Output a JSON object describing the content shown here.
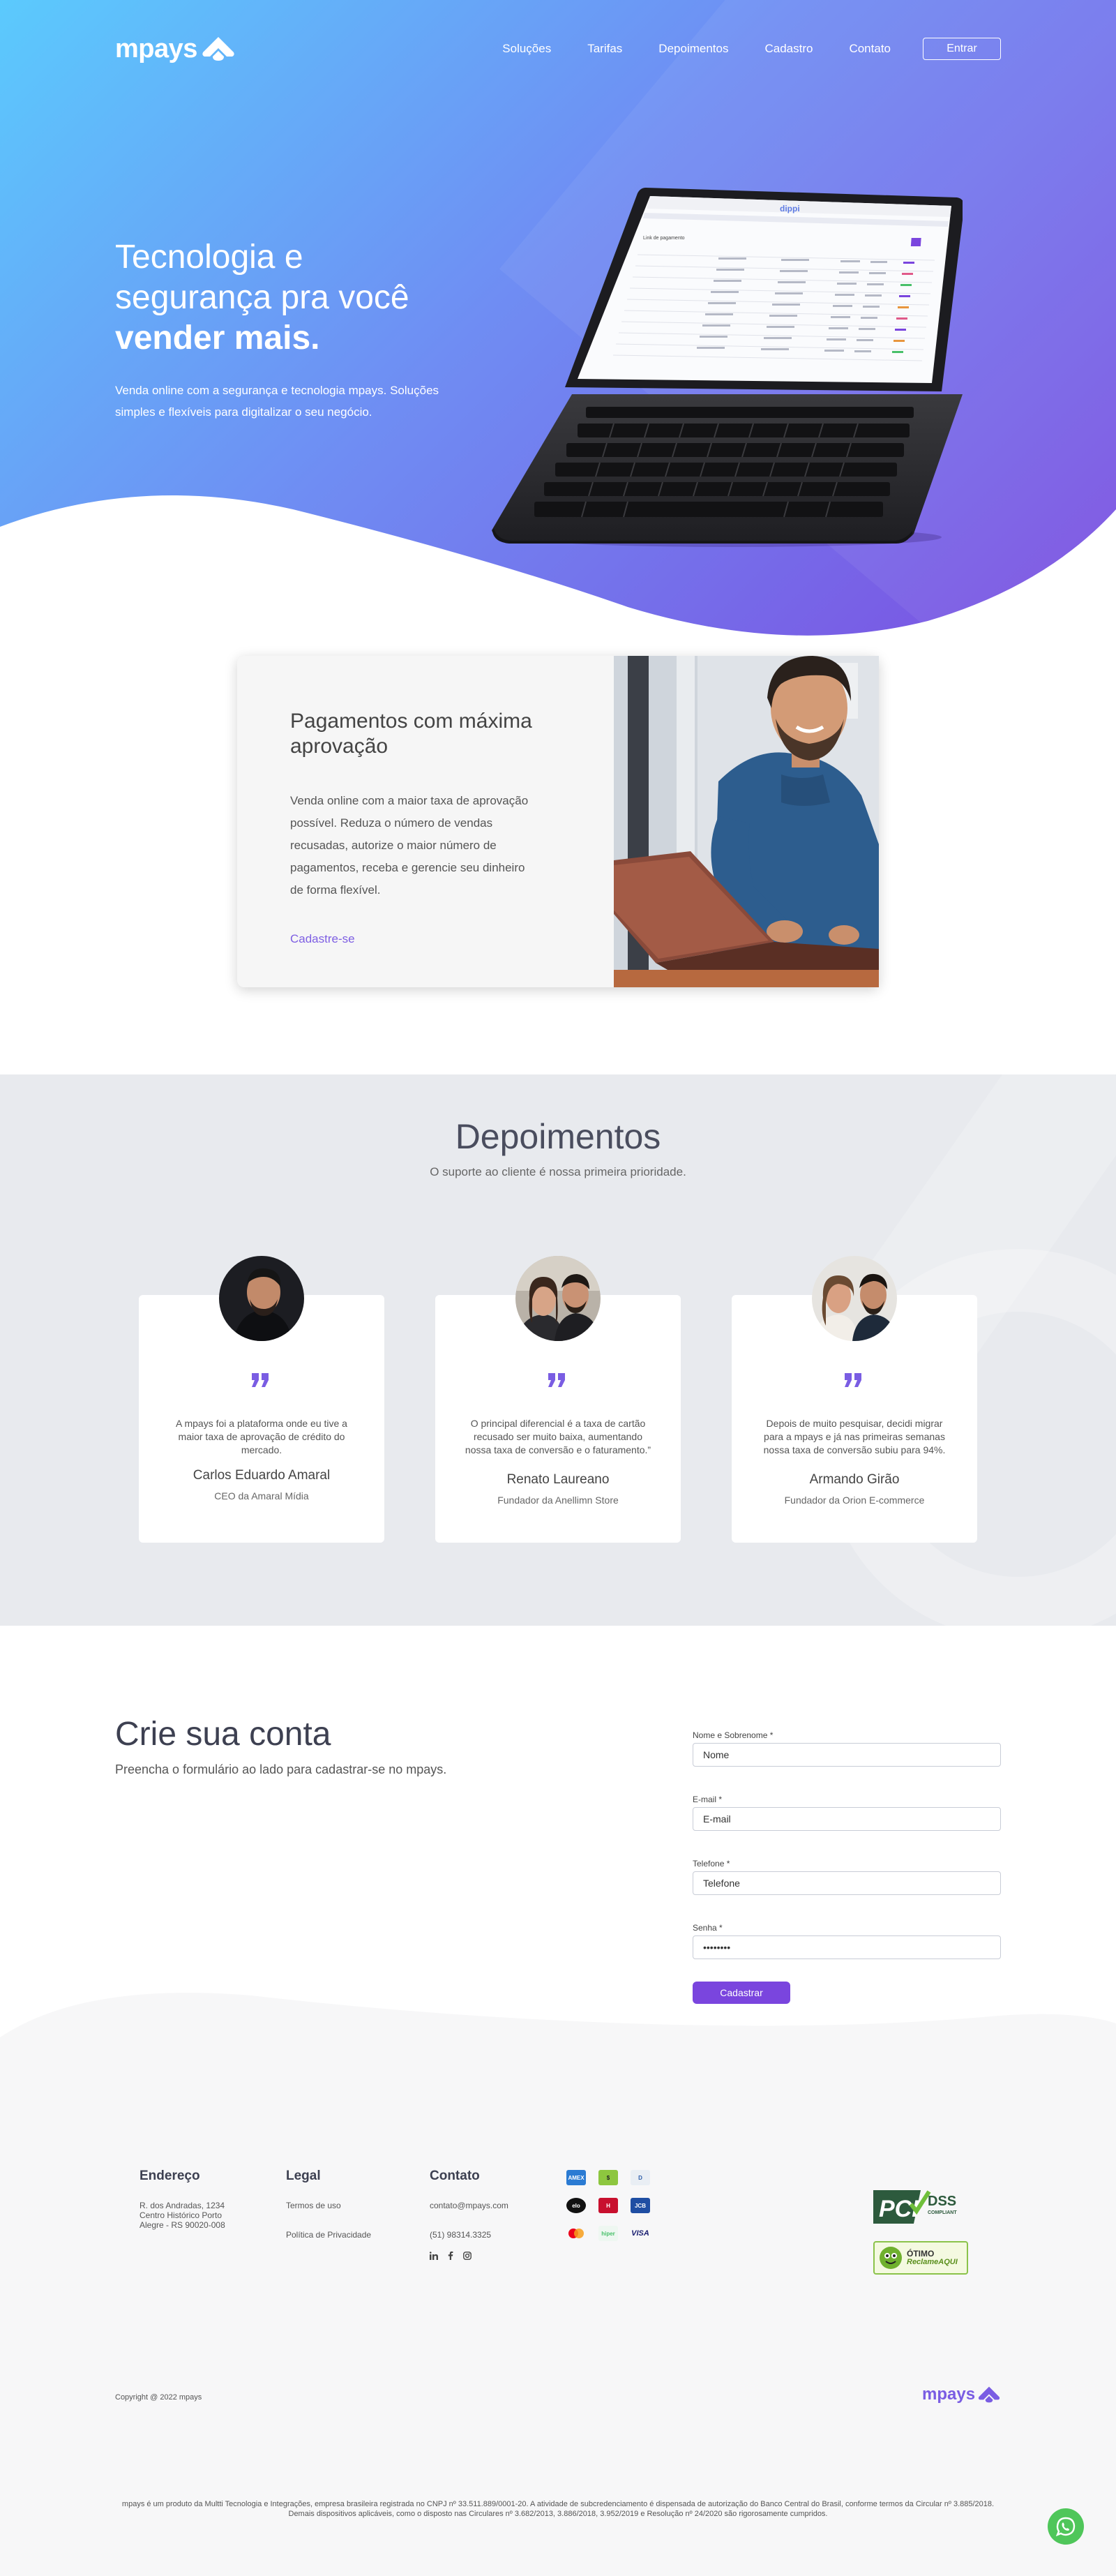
{
  "brand": {
    "name": "mpays"
  },
  "nav": {
    "items": [
      "Soluções",
      "Tarifas",
      "Depoimentos",
      "Cadastro",
      "Contato"
    ],
    "login_label": "Entrar"
  },
  "hero": {
    "title_line1": "Tecnologia e",
    "title_line2": "segurança pra você",
    "title_bold": "vender mais.",
    "subtitle": "Venda online com a segurança e tecnologia mpays. Soluções simples e flexíveis para digitalizar o seu negócio.",
    "screen_brand": "dippi",
    "screen_heading": "Link de pagamento"
  },
  "feature": {
    "title": "Pagamentos com máxima aprovação",
    "body": "Venda online com a maior taxa de aprovação possível. Reduza o número de vendas recusadas, autorize o maior número de pagamentos, receba e gerencie seu dinheiro de forma flexível.",
    "link": "Cadastre-se"
  },
  "testimonials": {
    "title": "Depoimentos",
    "subtitle": "O suporte ao cliente é nossa primeira prioridade.",
    "items": [
      {
        "text": "A mpays foi a plataforma onde eu tive a maior taxa de aprovação de crédito do mercado.",
        "name": "Carlos Eduardo Amaral",
        "role": "CEO da Amaral Mídia"
      },
      {
        "text": "O principal diferencial é a taxa de cartão recusado ser muito baixa, aumentando nossa taxa de conversão e o faturamento.”",
        "name": "Renato Laureano",
        "role": "Fundador da Anellimn Store"
      },
      {
        "text": "Depois de muito pesquisar, decidi migrar para a mpays e já nas primeiras semanas nossa taxa de conversão subiu para 94%.",
        "name": "Armando Girão",
        "role": "Fundador da Orion E-commerce"
      }
    ]
  },
  "signup": {
    "title": "Crie sua conta",
    "subtitle": "Preencha o formulário ao lado para cadastrar-se no mpays.",
    "fields": [
      {
        "label": "Nome e Sobrenome *",
        "placeholder": "Nome",
        "type": "text"
      },
      {
        "label": "E-mail *",
        "placeholder": "E-mail",
        "type": "text"
      },
      {
        "label": "Telefone *",
        "placeholder": "Telefone",
        "type": "text"
      },
      {
        "label": "Senha *",
        "value": "••••••••",
        "type": "password"
      }
    ],
    "submit_label": "Cadastrar"
  },
  "footer": {
    "address": {
      "title": "Endereço",
      "lines": [
        "R. dos Andradas, 1234",
        "Centro Histórico Porto",
        "Alegre - RS 90020-008"
      ]
    },
    "legal": {
      "title": "Legal",
      "links": [
        "Termos de uso",
        "Política de Privacidade"
      ]
    },
    "contact": {
      "title": "Contato",
      "email": "contato@mpays.com",
      "phone": "(51) 98314.3325"
    },
    "social_icons": [
      "linkedin-icon",
      "facebook-icon",
      "instagram-icon"
    ],
    "card_brands": [
      "American Express",
      "Elo",
      "Diners",
      "Cabal",
      "Hipercard",
      "JCB",
      "Mastercard",
      "Hiper",
      "VISA"
    ],
    "badges": {
      "pci": "PCI DSS",
      "pci_sub": "COMPLIANT",
      "ra_top": "ÓTIMO",
      "ra_bottom": "ReclameAQUI"
    },
    "copyright": "Copyright @ 2022 mpays",
    "legal_text": "mpays é um produto da Multti Tecnologia e Integrações, empresa brasileira registrada no CNPJ nº 33.511.889/0001-20. A atividade de subcredenciamento é dispensada de autorização do Banco Central do Brasil, conforme termos da Circular nº 3.885/2018. Demais dispositivos aplicáveis, como o disposto nas Circulares nº 3.682/2013, 3.886/2018, 3.952/2019 e Resolução nº 24/2020 são rigorosamente cumpridos."
  },
  "colors": {
    "accent": "#7a45de",
    "hero_start": "#5bcafd",
    "hero_end": "#7c4ce0",
    "whatsapp": "#4fc65a"
  }
}
